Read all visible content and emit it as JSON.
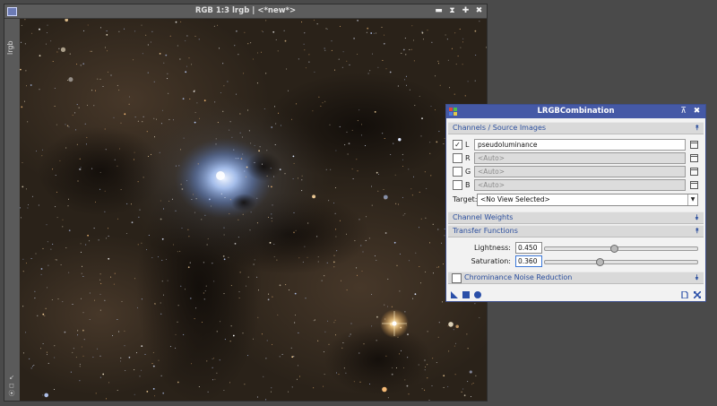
{
  "image_window": {
    "title": "RGB 1:3 lrgb | <*new*>",
    "side_tab_label": "lrgb",
    "title_buttons": [
      "▬",
      "⧗",
      "✚",
      "✖"
    ],
    "side_icons": [
      "↙",
      "◻",
      "⦿"
    ]
  },
  "dialog": {
    "title": "LRGBCombination",
    "title_buttons": [
      "⊼",
      "✖"
    ],
    "sections": {
      "channels": "Channels / Source Images",
      "weights": "Channel Weights",
      "transfer": "Transfer Functions",
      "chrominance": "Chrominance Noise Reduction"
    },
    "channels": [
      {
        "letter": "L",
        "checked": true,
        "check_mark": "✓",
        "value": "pseudoluminance"
      },
      {
        "letter": "R",
        "checked": false,
        "check_mark": "",
        "value": "<Auto>"
      },
      {
        "letter": "G",
        "checked": false,
        "check_mark": "",
        "value": "<Auto>"
      },
      {
        "letter": "B",
        "checked": false,
        "check_mark": "",
        "value": "<Auto>"
      }
    ],
    "target": {
      "label": "Target:",
      "value": "<No View Selected>"
    },
    "lightness": {
      "label": "Lightness:",
      "value": "0.450",
      "level": 0.45
    },
    "saturation": {
      "label": "Saturation:",
      "value": "0.360",
      "level": 0.36
    },
    "chevrons": {
      "up": "⯭",
      "down": "⯯"
    }
  },
  "colors": {
    "dialog_title": "#4559a6",
    "section_text": "#2c4f9e",
    "footer_icon": "#2a4fa8"
  }
}
